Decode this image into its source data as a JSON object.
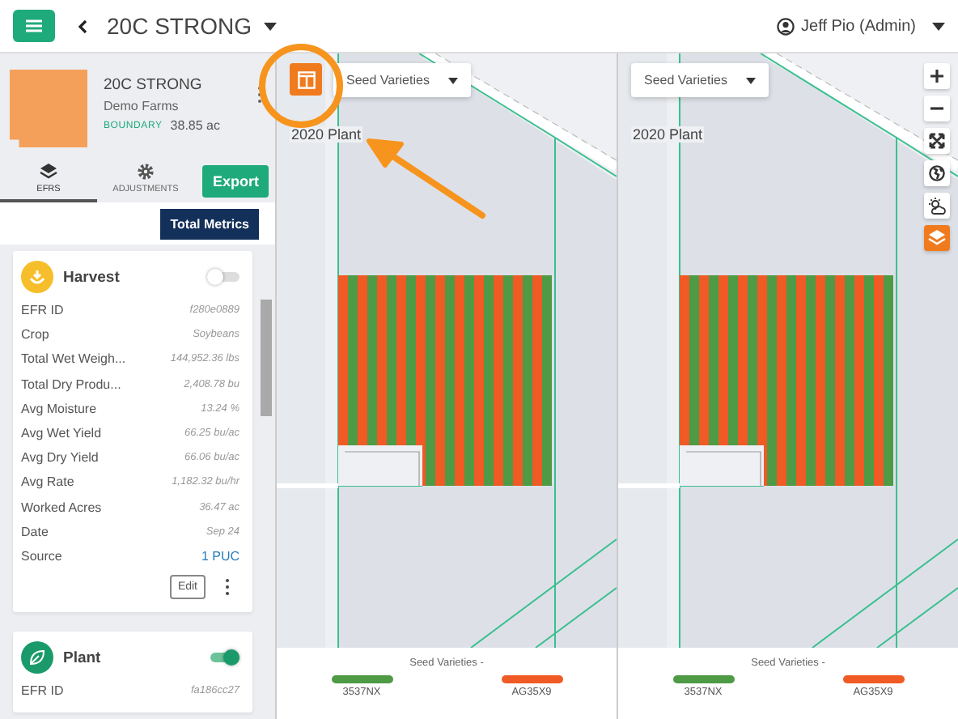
{
  "header": {
    "title": "20C STRONG",
    "user": "Jeff Pio (Admin)"
  },
  "field": {
    "name": "20C STRONG",
    "farm": "Demo Farms",
    "badge": "BOUNDARY",
    "area": "38.85 ac"
  },
  "tabs": [
    {
      "label": "EFRS",
      "kind": "layers",
      "selected": true
    },
    {
      "label": "ADJUSTMENTS",
      "kind": "gear",
      "selected": false
    }
  ],
  "export_button": "Export",
  "total_metrics_button": "Total Metrics",
  "cards": [
    {
      "title": "Harvest",
      "kind": "harvest",
      "on": false,
      "edit_button": "Edit",
      "rows": [
        {
          "label": "EFR ID",
          "value": "f280e0889",
          "kind": "text"
        },
        {
          "label": "Crop",
          "value": "Soybeans",
          "kind": "text"
        },
        {
          "label": "Total Wet Weigh...",
          "value": "144,952.36 lbs",
          "kind": "text"
        },
        {
          "label": "Total Dry Produ...",
          "value": "2,408.78 bu",
          "kind": "text"
        },
        {
          "label": "Avg Moisture",
          "value": "13.24 %",
          "kind": "text"
        },
        {
          "label": "Avg Wet Yield",
          "value": "66.25 bu/ac",
          "kind": "text"
        },
        {
          "label": "Avg Dry Yield",
          "value": "66.06 bu/ac",
          "kind": "text"
        },
        {
          "label": "Avg Rate",
          "value": "1,182.32 bu/hr",
          "kind": "text"
        },
        {
          "label": "Worked Acres",
          "value": "36.47 ac",
          "kind": "text"
        },
        {
          "label": "Date",
          "value": "Sep 24",
          "kind": "text"
        },
        {
          "label": "Source",
          "value": "1 PUC",
          "kind": "link"
        }
      ]
    },
    {
      "title": "Plant",
      "kind": "plant",
      "on": true,
      "rows": [
        {
          "label": "EFR ID",
          "value": "fa186cc27",
          "kind": "text"
        }
      ]
    }
  ],
  "maps": [
    {
      "dropdown": "Seed Varieties",
      "layer": "2020 Plant",
      "layout_toggle": true,
      "legend": {
        "title": "Seed Varieties -",
        "items": [
          {
            "label": "3537NX",
            "color": "#4e9a45"
          },
          {
            "label": "AG35X9",
            "color": "#f05a24"
          }
        ]
      }
    },
    {
      "dropdown": "Seed Varieties",
      "layer": "2020 Plant",
      "layout_toggle": false,
      "legend": {
        "title": "Seed Varieties -",
        "items": [
          {
            "label": "3537NX",
            "color": "#4e9a45"
          },
          {
            "label": "AG35X9",
            "color": "#f05a24"
          }
        ]
      }
    }
  ],
  "map_controls": [
    {
      "kind": "zoom-in",
      "selected": false
    },
    {
      "kind": "zoom-out",
      "selected": false
    },
    {
      "kind": "fullscreen",
      "selected": false
    },
    {
      "kind": "globe",
      "selected": false
    },
    {
      "kind": "weather",
      "selected": false
    },
    {
      "kind": "layers",
      "selected": true
    }
  ]
}
